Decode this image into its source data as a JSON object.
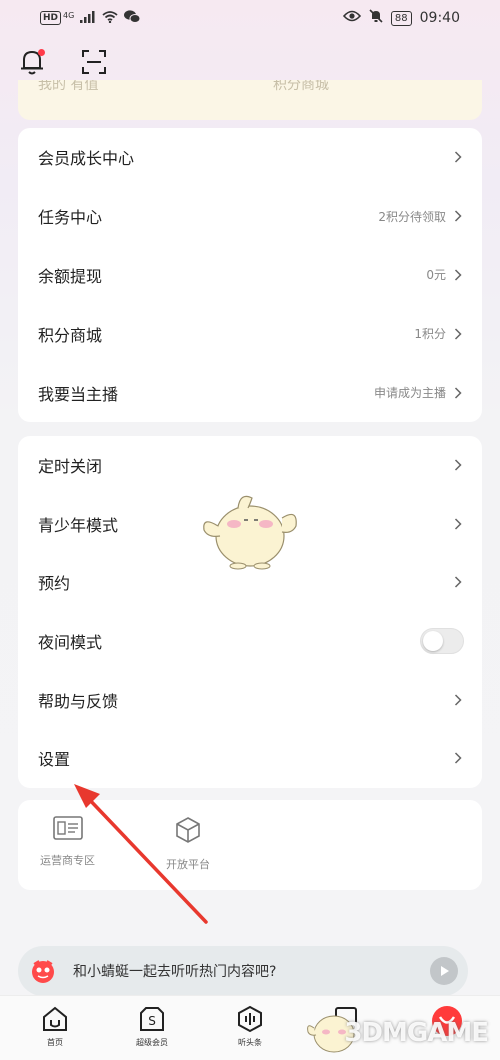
{
  "status_bar": {
    "network_badge": "HD",
    "signal": "4G",
    "battery": "88",
    "time": "09:40"
  },
  "banner_peek": {
    "left_text": "我的 有值",
    "right_text": "积分商城"
  },
  "menu_group_1": [
    {
      "label": "会员成长中心",
      "value": ""
    },
    {
      "label": "任务中心",
      "value": "2积分待领取"
    },
    {
      "label": "余额提现",
      "value": "0元"
    },
    {
      "label": "积分商城",
      "value": "1积分"
    },
    {
      "label": "我要当主播",
      "value": "申请成为主播"
    }
  ],
  "menu_group_2": [
    {
      "label": "定时关闭"
    },
    {
      "label": "青少年模式"
    },
    {
      "label": "预约"
    },
    {
      "label": "夜间模式",
      "toggle": false
    },
    {
      "label": "帮助与反馈"
    },
    {
      "label": "设置"
    }
  ],
  "tools": [
    {
      "label": "运营商专区",
      "icon": "operator-card-icon"
    },
    {
      "label": "开放平台",
      "icon": "cube-icon"
    }
  ],
  "promo": {
    "text": "和小蜻蜓一起去听听热门内容吧?"
  },
  "tabs": [
    {
      "label": "首页",
      "icon": "home-icon"
    },
    {
      "label": "超级会员",
      "icon": "vip-icon"
    },
    {
      "label": "听头条",
      "icon": "audio-wave-icon"
    },
    {
      "label": "",
      "icon": "library-icon"
    },
    {
      "label": "",
      "icon": "me-icon"
    }
  ],
  "watermark": "3DMGAME",
  "colors": {
    "accent_red": "#ff3b3b",
    "arrow_red": "#e8382e",
    "card_bg": "#ffffff"
  }
}
